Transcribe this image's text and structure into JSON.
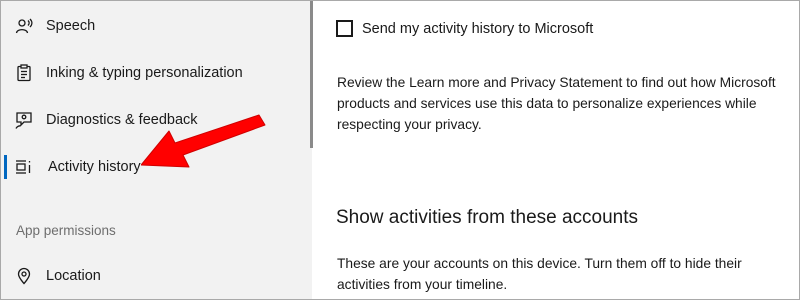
{
  "sidebar": {
    "items": [
      {
        "label": "Speech",
        "icon": "speech-icon"
      },
      {
        "label": "Inking & typing personalization",
        "icon": "clipboard-icon"
      },
      {
        "label": "Diagnostics & feedback",
        "icon": "feedback-person-icon"
      },
      {
        "label": "Activity history",
        "icon": "activity-history-icon",
        "active": true
      }
    ],
    "section_header": "App permissions",
    "section_items": [
      {
        "label": "Location",
        "icon": "location-pin-icon"
      }
    ]
  },
  "main": {
    "send_history_label": "Send my activity history to Microsoft",
    "send_history_checked": false,
    "description_lines": [
      "Review the Learn more and Privacy Statement to find out how Microsoft",
      "products and services use this data to personalize experiences while",
      "respecting your privacy."
    ],
    "accounts_title": "Show activities from these accounts",
    "accounts_desc_lines": [
      "These are your accounts on this device. Turn them off to hide their",
      "activities from your timeline."
    ]
  },
  "colors": {
    "accent": "#0067c0",
    "annotation_arrow": "#ff0000",
    "sidebar_bg": "#f2f2f2"
  }
}
